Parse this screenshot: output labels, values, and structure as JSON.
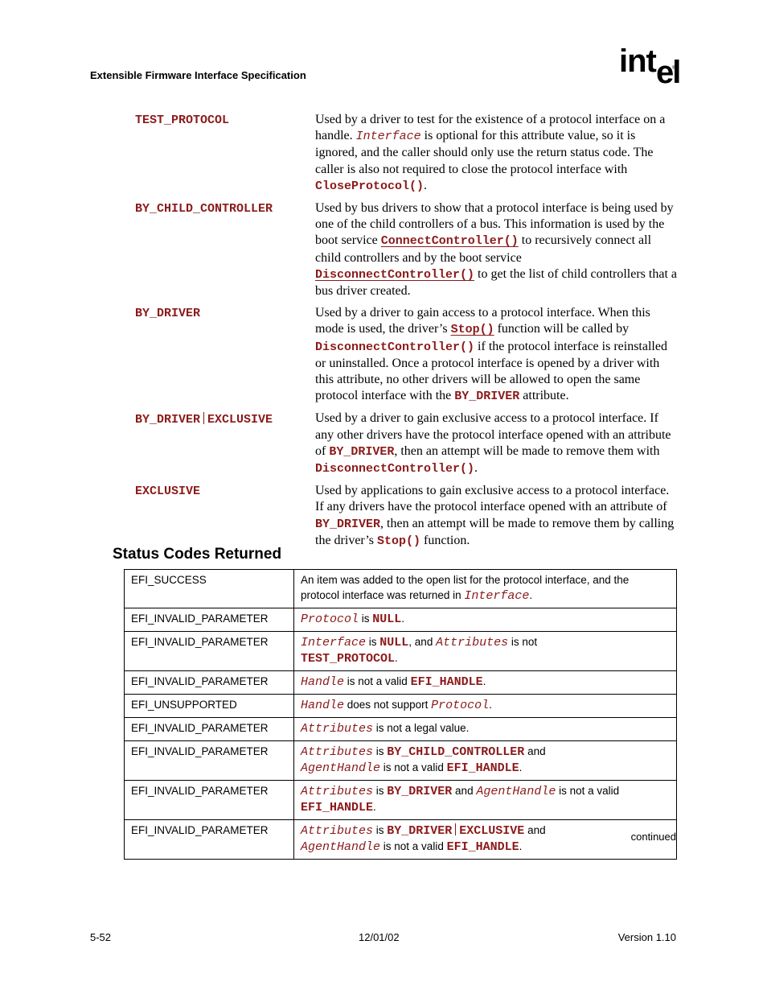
{
  "header": {
    "title": "Extensible Firmware Interface Specification",
    "logo_text_a": "int",
    "logo_text_b": "el",
    "logo_reg": "®"
  },
  "definitions": [
    {
      "term": "TEST_PROTOCOL",
      "segments": [
        {
          "t": "Used by a driver to test for the existence of a protocol interface on a handle.  "
        },
        {
          "t": "Interface",
          "s": "ital"
        },
        {
          "t": " is optional for this attribute value, so it is ignored, and the caller should only use the return status code.  The caller is also not required to close the protocol interface with "
        },
        {
          "t": "CloseProtocol()",
          "s": "code"
        },
        {
          "t": "."
        }
      ]
    },
    {
      "term": "BY_CHILD_CONTROLLER",
      "segments": [
        {
          "t": "Used by bus drivers to show that a protocol interface is being used by one of the child controllers of a bus.  This information is used by the boot service "
        },
        {
          "t": "ConnectController()",
          "s": "link"
        },
        {
          "t": " to recursively connect all child controllers and by the boot service "
        },
        {
          "t": "DisconnectController()",
          "s": "link"
        },
        {
          "t": " to get the list of child controllers that a bus driver created."
        }
      ]
    },
    {
      "term": "BY_DRIVER",
      "segments": [
        {
          "t": "Used by a driver to gain access to a protocol interface.  When this mode is used, the driver’s "
        },
        {
          "t": "Stop()",
          "s": "link"
        },
        {
          "t": " function will be called by "
        },
        {
          "t": "DisconnectController()",
          "s": "code"
        },
        {
          "t": " if the protocol interface is reinstalled or uninstalled.  Once a protocol interface is opened by a driver with this attribute, no other drivers will be allowed to open the same protocol interface with the "
        },
        {
          "t": "BY_DRIVER",
          "s": "code"
        },
        {
          "t": " attribute."
        }
      ]
    },
    {
      "term_parts": [
        "BY_DRIVER",
        "EXCLUSIVE"
      ],
      "segments": [
        {
          "t": "Used by a driver to gain exclusive access to a protocol interface.  If any other drivers have the protocol interface opened with an attribute of "
        },
        {
          "t": "BY_DRIVER",
          "s": "code"
        },
        {
          "t": ", then an attempt will be made to remove them with "
        },
        {
          "t": "DisconnectController()",
          "s": "code"
        },
        {
          "t": "."
        }
      ]
    },
    {
      "term": "EXCLUSIVE",
      "segments": [
        {
          "t": "Used by applications to gain exclusive access to a protocol interface.  If any drivers have the protocol interface opened with an attribute of "
        },
        {
          "t": "BY_DRIVER",
          "s": "code"
        },
        {
          "t": ", then an attempt will be made to remove them by calling the driver’s "
        },
        {
          "t": "Stop()",
          "s": "code"
        },
        {
          "t": " function."
        }
      ]
    }
  ],
  "status_section": {
    "heading": "Status Codes Returned",
    "rows": [
      {
        "code": "EFI_SUCCESS",
        "desc": [
          {
            "t": "An item was added to the open list for the protocol interface, and the protocol interface was returned in "
          },
          {
            "t": "Interface",
            "s": "ital"
          },
          {
            "t": "."
          }
        ]
      },
      {
        "code": "EFI_INVALID_PARAMETER",
        "desc": [
          {
            "t": "Protocol",
            "s": "ital"
          },
          {
            "t": " is "
          },
          {
            "t": "NULL",
            "s": "code"
          },
          {
            "t": "."
          }
        ]
      },
      {
        "code": "EFI_INVALID_PARAMETER",
        "desc": [
          {
            "t": "Interface",
            "s": "ital"
          },
          {
            "t": " is "
          },
          {
            "t": "NULL",
            "s": "code"
          },
          {
            "t": ", and "
          },
          {
            "t": "Attributes",
            "s": "ital"
          },
          {
            "t": " is not "
          },
          {
            "t": "TEST_PROTOCOL",
            "s": "code",
            "br": true
          },
          {
            "t": "."
          }
        ]
      },
      {
        "code": "EFI_INVALID_PARAMETER",
        "desc": [
          {
            "t": "Handle",
            "s": "ital"
          },
          {
            "t": " is not a valid "
          },
          {
            "t": "EFI_HANDLE",
            "s": "code"
          },
          {
            "t": "."
          }
        ]
      },
      {
        "code": "EFI_UNSUPPORTED",
        "desc": [
          {
            "t": "Handle",
            "s": "ital"
          },
          {
            "t": " does not support "
          },
          {
            "t": "Protocol",
            "s": "ital"
          },
          {
            "t": "."
          }
        ]
      },
      {
        "code": "EFI_INVALID_PARAMETER",
        "desc": [
          {
            "t": "Attributes",
            "s": "ital"
          },
          {
            "t": " is not a legal value."
          }
        ]
      },
      {
        "code": "EFI_INVALID_PARAMETER",
        "desc": [
          {
            "t": "Attributes",
            "s": "ital"
          },
          {
            "t": " is "
          },
          {
            "t": "BY_CHILD_CONTROLLER",
            "s": "code"
          },
          {
            "t": " and "
          },
          {
            "t": "AgentHandle",
            "s": "ital",
            "br": true
          },
          {
            "t": " is not a valid "
          },
          {
            "t": "EFI_HANDLE",
            "s": "code"
          },
          {
            "t": "."
          }
        ]
      },
      {
        "code": "EFI_INVALID_PARAMETER",
        "desc": [
          {
            "t": "Attributes",
            "s": "ital"
          },
          {
            "t": " is "
          },
          {
            "t": "BY_DRIVER",
            "s": "code"
          },
          {
            "t": " and "
          },
          {
            "t": "AgentHandle",
            "s": "ital"
          },
          {
            "t": " is not a valid "
          },
          {
            "t": "EFI_HANDLE",
            "s": "code",
            "br": true
          },
          {
            "t": "."
          }
        ]
      },
      {
        "code": "EFI_INVALID_PARAMETER",
        "desc": [
          {
            "t": "Attributes",
            "s": "ital"
          },
          {
            "t": " is "
          },
          {
            "t": "BY_DRIVER",
            "s": "code"
          },
          {
            "t": "|",
            "s": "bar"
          },
          {
            "t": "EXCLUSIVE",
            "s": "code"
          },
          {
            "t": " and "
          },
          {
            "t": "AgentHandle",
            "s": "ital",
            "br": true
          },
          {
            "t": " is not a valid "
          },
          {
            "t": "EFI_HANDLE",
            "s": "code"
          },
          {
            "t": "."
          }
        ]
      }
    ],
    "continued_label": "continued"
  },
  "footer": {
    "page_number": "5-52",
    "date": "12/01/02",
    "version": "Version 1.10"
  },
  "colors": {
    "code_red": "#8b1a1a"
  }
}
